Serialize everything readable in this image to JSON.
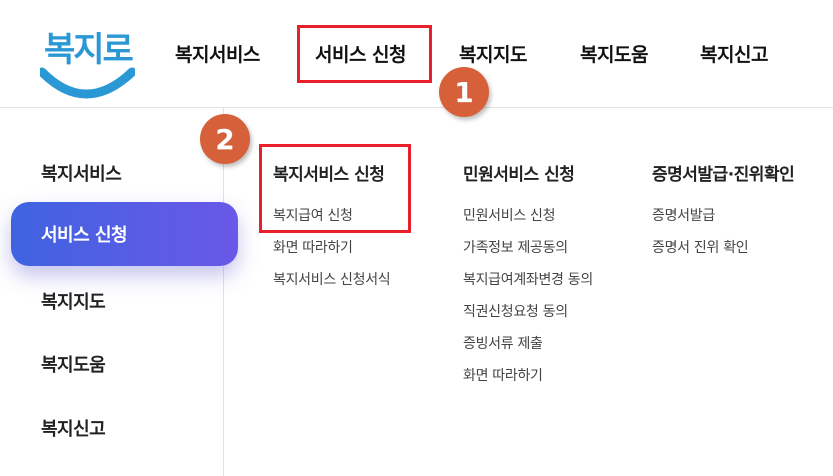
{
  "logo": {
    "text": "복지로"
  },
  "nav": {
    "items": [
      "복지서비스",
      "서비스 신청",
      "복지지도",
      "복지도움",
      "복지신고"
    ]
  },
  "badges": [
    "1",
    "2"
  ],
  "sidebar": {
    "items": [
      "복지서비스",
      "서비스 신청",
      "복지지도",
      "복지도움",
      "복지신고"
    ]
  },
  "columns": [
    {
      "title": "복지서비스 신청",
      "links": [
        "복지급여 신청",
        "화면 따라하기",
        "복지서비스 신청서식"
      ]
    },
    {
      "title": "민원서비스 신청",
      "links": [
        "민원서비스 신청",
        "가족정보 제공동의",
        "복지급여계좌변경 동의",
        "직권신청요청 동의",
        "증빙서류 제출",
        "화면 따라하기"
      ]
    },
    {
      "title": "증명서발급·진위확인",
      "links": [
        "증명서발급",
        "증명서 진위 확인"
      ]
    }
  ],
  "colors": {
    "accent_red": "#e8202a",
    "badge": "#d5603a",
    "active_start": "#3f63e0",
    "active_end": "#6a58e8",
    "logo_blue": "#2b98d6"
  }
}
